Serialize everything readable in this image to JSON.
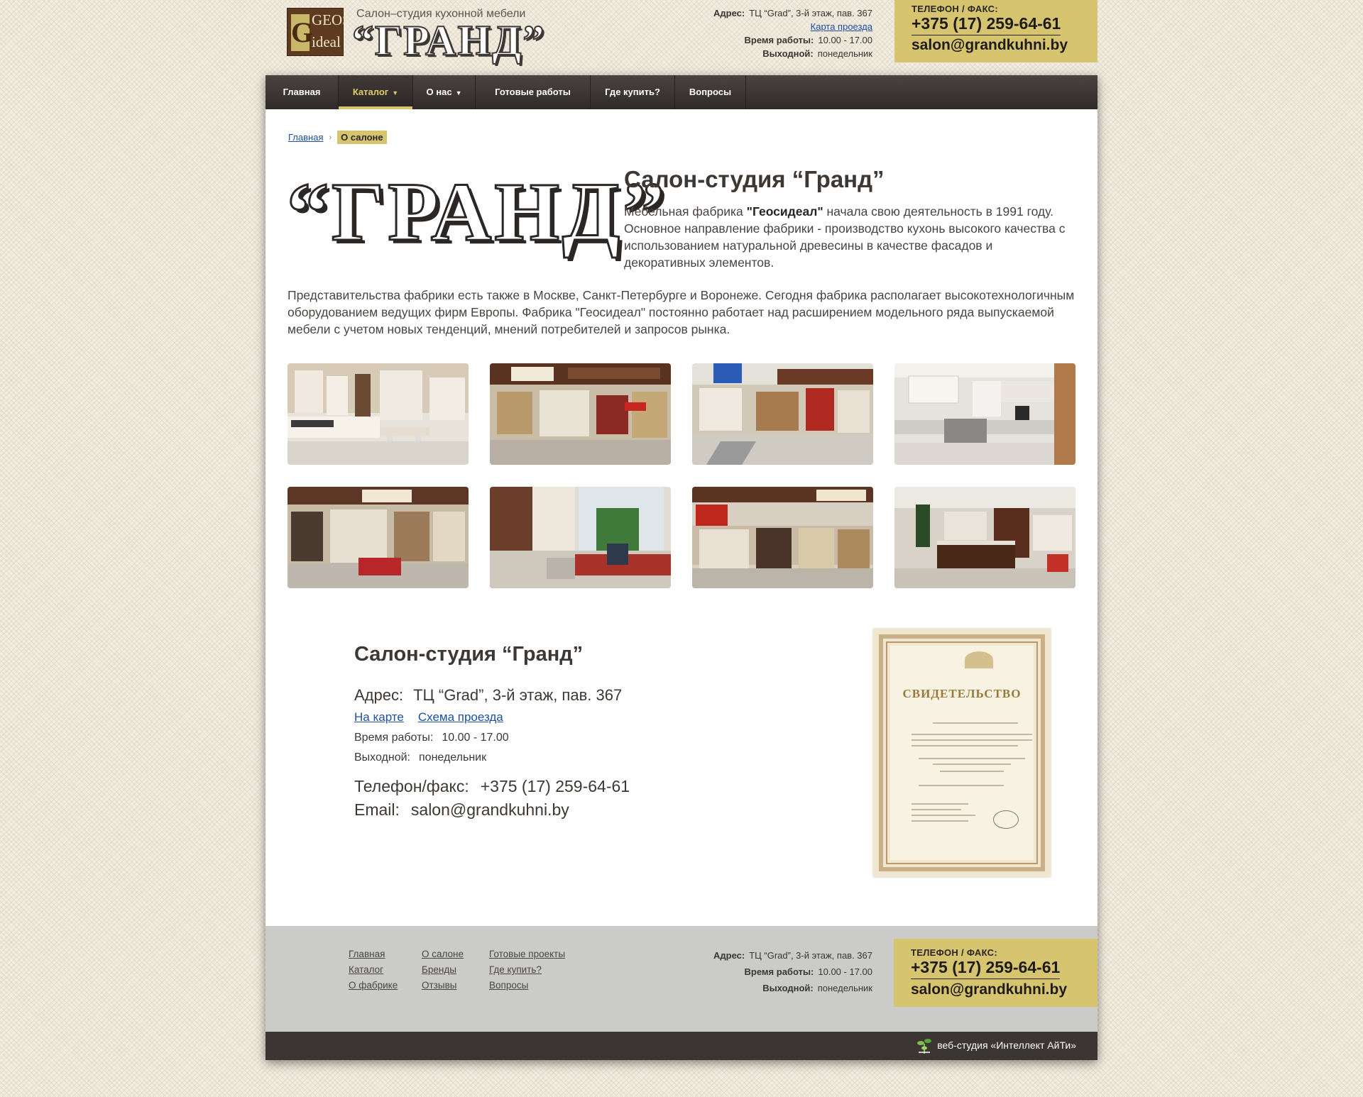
{
  "header": {
    "logo": {
      "g": "G",
      "geos": "GEOS",
      "ideal": "ideal",
      "subtitle": "Салон–студия кухонной мебели",
      "name": "“ГРАНД”"
    },
    "address_label": "Адрес:",
    "address": "ТЦ “Grad”, 3-й этаж, пав. 367",
    "map_link": "Карта проезда",
    "hours_label": "Время работы:",
    "hours": "10.00 - 17.00",
    "dayoff_label": "Выходной:",
    "dayoff": "понедельник",
    "phone_caption": "ТЕЛЕФОН / ФАКС:",
    "phone": "+375 (17) 259-64-61",
    "email": "salon@grandkuhni.by"
  },
  "nav": [
    {
      "label": "Главная",
      "active": false,
      "caret": ""
    },
    {
      "label": "Каталог",
      "active": true,
      "caret": "▼"
    },
    {
      "label": "О нас",
      "active": false,
      "caret": "▼"
    },
    {
      "label": "Готовые работы",
      "active": false,
      "caret": ""
    },
    {
      "label": "Где купить?",
      "active": false,
      "caret": ""
    },
    {
      "label": "Вопросы",
      "active": false,
      "caret": ""
    }
  ],
  "breadcrumb": {
    "home": "Главная",
    "sep": "›",
    "current": "О салоне"
  },
  "main": {
    "big_logo": "“ГРАНД”",
    "title": "Салон-студия “Гранд”",
    "lead_1": "Мебельная фабрика ",
    "lead_bold": "\"Геосидеал\"",
    "lead_2": " начала свою деятельность в 1991 году. Основное направление фабрики - производство кухонь высокого качества с использованием натуральной древесины в качестве фасадов и декоративных элементов.",
    "paragraph": "Представительства фабрики есть также в Москве, Санкт-Петербурге и Воронеже. Сегодня фабрика располагает высокотехнологичным оборудованием ведущих фирм Европы. Фабрика \"Геосидеал\" постоянно работает над расширением модельного ряда выпускаемой мебели с учетом новых тенденций, мнений потребителей и запросов рынка."
  },
  "gallery": [
    {
      "scene": "white kitchen"
    },
    {
      "scene": "showroom stand"
    },
    {
      "scene": "showroom stand"
    },
    {
      "scene": "white kitchen"
    },
    {
      "scene": "showroom stand"
    },
    {
      "scene": "office desk"
    },
    {
      "scene": "showroom stand"
    },
    {
      "scene": "dark kitchen"
    }
  ],
  "contacts": {
    "title": "Салон-студия “Гранд”",
    "address_label": "Адрес:",
    "address": "ТЦ “Grad”, 3-й этаж, пав. 367",
    "map_link": "На карте",
    "route_link": "Схема проезда",
    "hours_label": "Время работы:",
    "hours": "10.00 - 17.00",
    "dayoff_label": "Выходной:",
    "dayoff": "понедельник",
    "phone_label": "Телефон/факс:",
    "phone": "+375 (17) 259-64-61",
    "email_label": "Email:",
    "email": "salon@grandkuhni.by"
  },
  "certificate": {
    "heading": "СВИДЕТЕЛЬСТВО"
  },
  "footer": {
    "col1": [
      "Главная",
      "Каталог",
      "О фабрике"
    ],
    "col2": [
      "О салоне",
      "Бренды",
      "Отзывы"
    ],
    "col3": [
      "Готовые проекты",
      "Где купить?",
      "Вопросы"
    ],
    "address_label": "Адрес:",
    "address": "ТЦ “Grad”, 3-й этаж, пав. 367",
    "hours_label": "Время работы:",
    "hours": "10.00 - 17.00",
    "dayoff_label": "Выходной:",
    "dayoff": "понедельник",
    "phone_caption": "ТЕЛЕФОН / ФАКС:",
    "phone": "+375 (17) 259-64-61",
    "email": "salon@grandkuhni.by",
    "studio": "веб-студия «Интеллект АйТи»"
  },
  "colors": {
    "accent": "#d6c56e",
    "nav": "#3b3534",
    "footer": "#cbcbca"
  }
}
